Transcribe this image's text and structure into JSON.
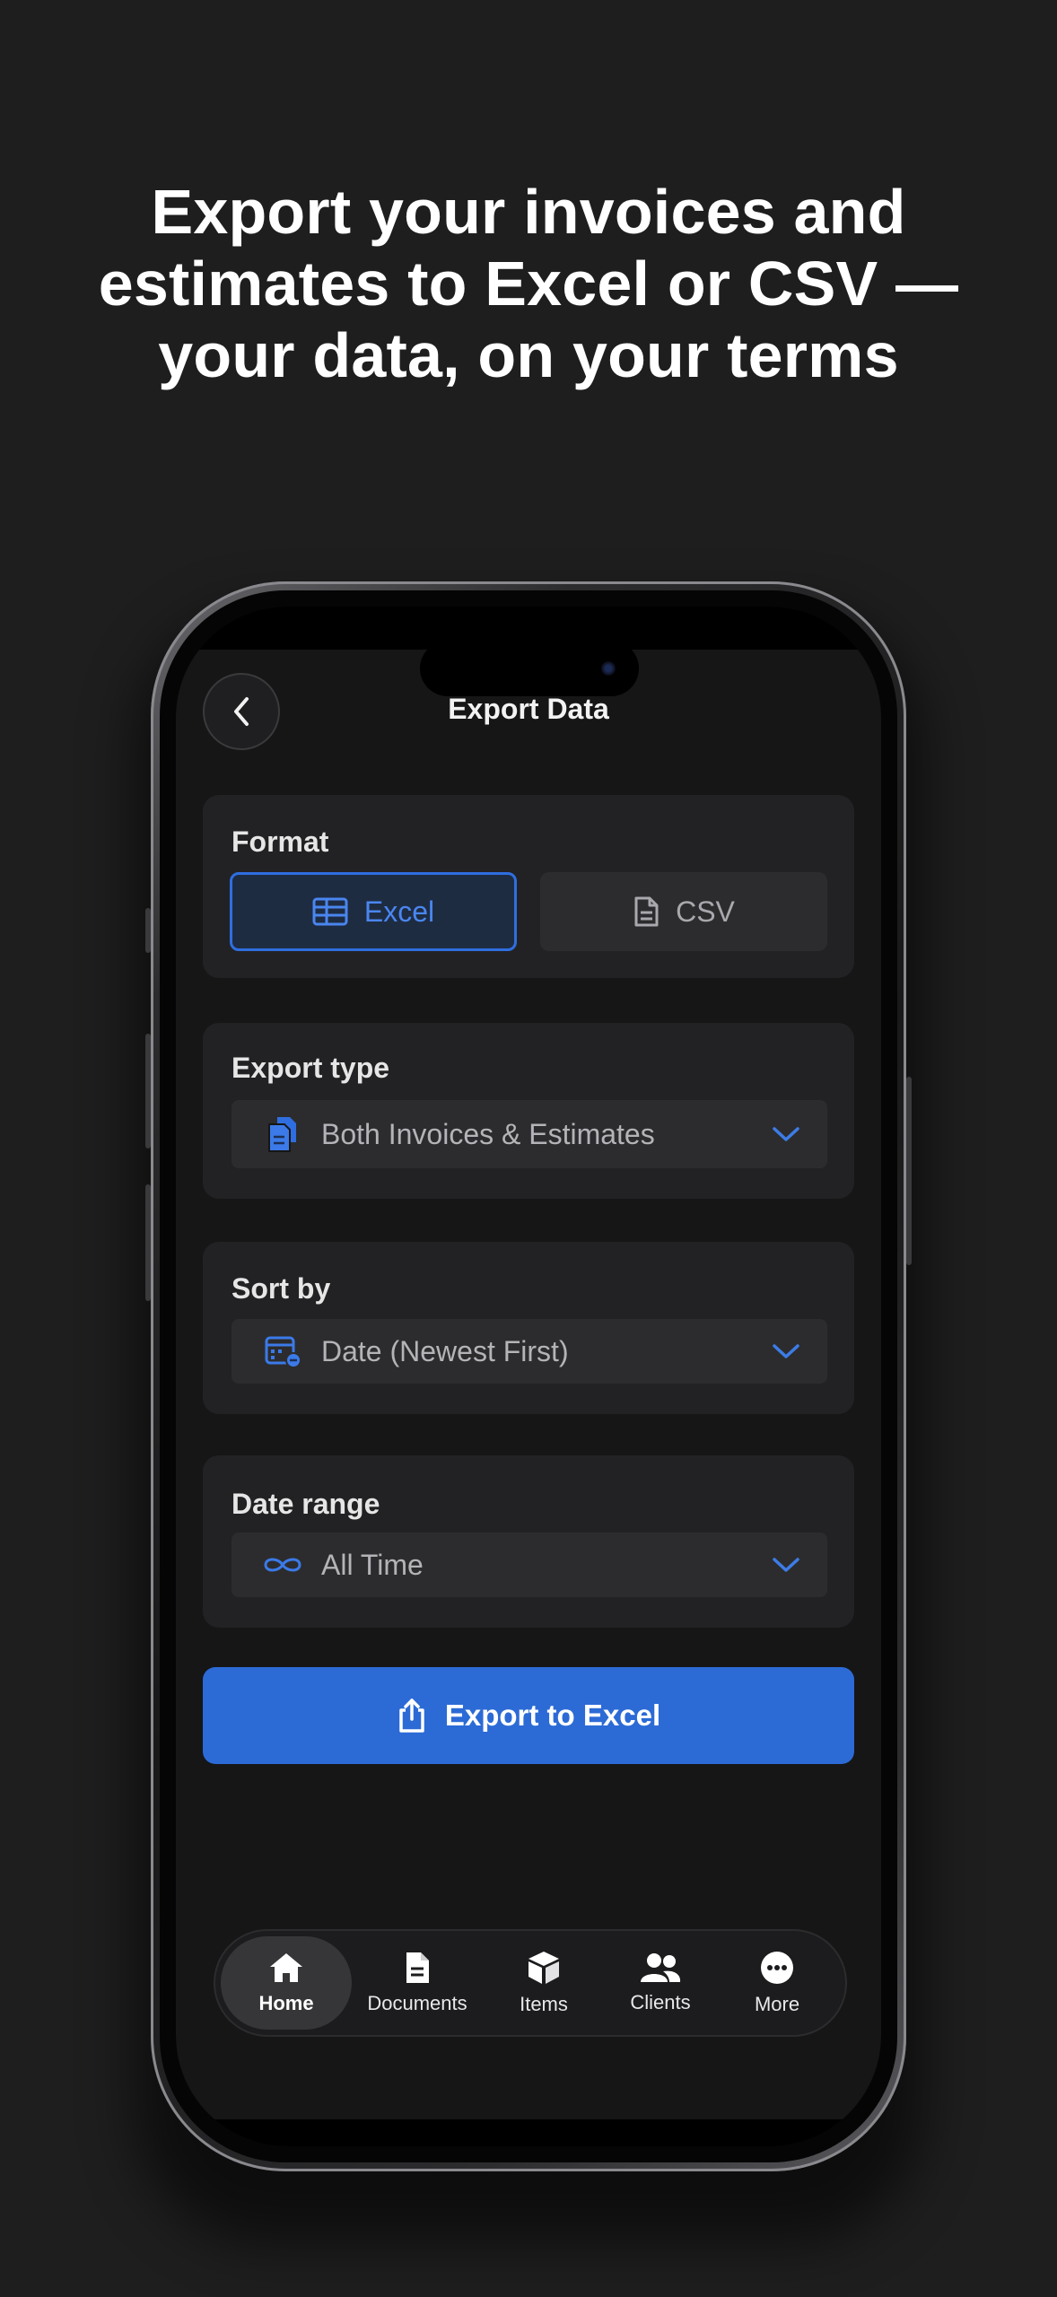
{
  "headline": {
    "line1": "Export your invoices and",
    "line2": "estimates to Excel or CSV —",
    "line3": "your data, on your terms"
  },
  "nav": {
    "back_icon": "chevron-left-icon",
    "title": "Export Data"
  },
  "format": {
    "label": "Format",
    "options": [
      {
        "label": "Excel",
        "icon": "table-icon",
        "selected": true
      },
      {
        "label": "CSV",
        "icon": "document-icon",
        "selected": false
      }
    ]
  },
  "export_type": {
    "label": "Export type",
    "value": "Both Invoices & Estimates",
    "icon": "documents-icon"
  },
  "sort_by": {
    "label": "Sort by",
    "value": "Date (Newest First)",
    "icon": "calendar-icon"
  },
  "date_range": {
    "label": "Date range",
    "value": "All Time",
    "icon": "infinity-icon"
  },
  "export_button": {
    "label": "Export to Excel",
    "icon": "share-icon"
  },
  "tabbar": {
    "items": [
      {
        "label": "Home",
        "icon": "home-icon",
        "active": true
      },
      {
        "label": "Documents",
        "icon": "document-icon",
        "active": false
      },
      {
        "label": "Items",
        "icon": "box-icon",
        "active": false
      },
      {
        "label": "Clients",
        "icon": "people-icon",
        "active": false
      },
      {
        "label": "More",
        "icon": "more-icon",
        "active": false
      }
    ]
  },
  "colors": {
    "background": "#1e1e1f",
    "accent": "#2c6bd6",
    "accent_text": "#4a86f0",
    "card": "#222224",
    "field": "#2c2c2e"
  }
}
